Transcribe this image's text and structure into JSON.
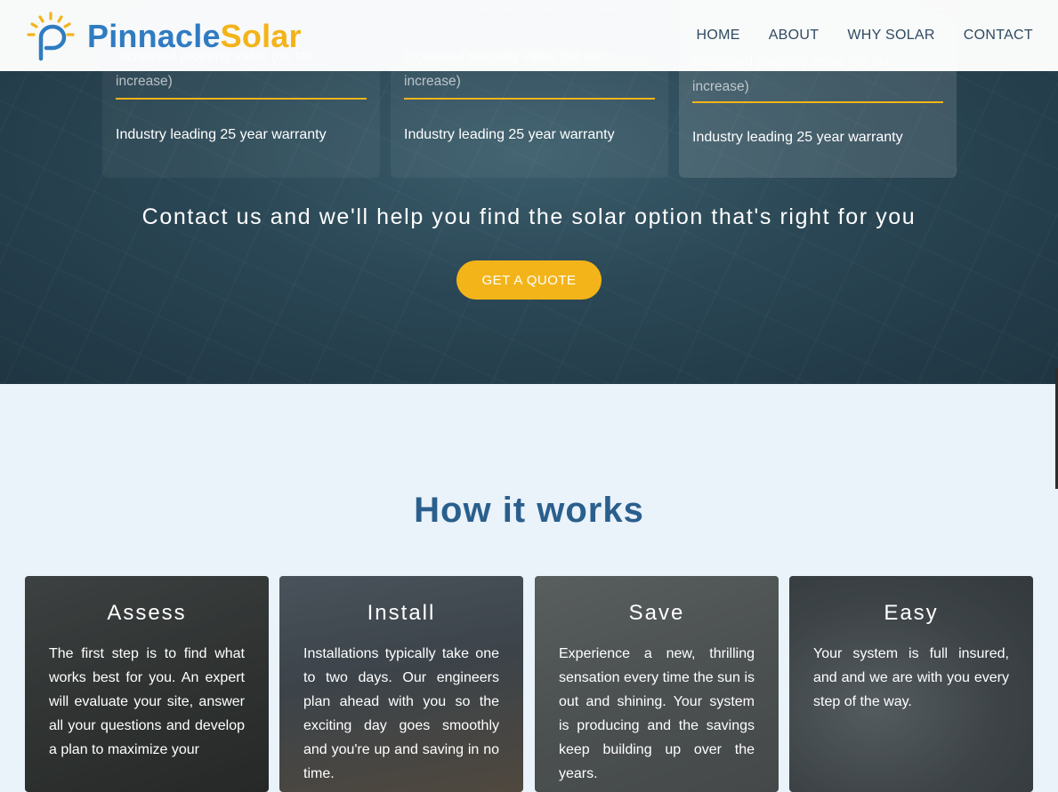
{
  "header": {
    "brand_part1": "Pinnacle",
    "brand_part2": "Solar",
    "logo_icon": "sun-p-logo-icon",
    "nav": [
      "HOME",
      "ABOUT",
      "WHY SOLAR",
      "CONTACT"
    ]
  },
  "plans": [
    {
      "feature": "Increased property value (no tax increase)",
      "warranty": "Industry leading 25 year warranty"
    },
    {
      "feature": "Increased property value (no tax increase)",
      "warranty": "Industry leading 25 year warranty"
    },
    {
      "feature": "Increased property value (no tax increase)",
      "warranty": "Industry leading 25 year warranty"
    }
  ],
  "cta": {
    "text": "Contact us and we'll help you find the solar option that's right for you",
    "button": "GET A QUOTE"
  },
  "how": {
    "title": "How it works",
    "steps": [
      {
        "title": "Assess",
        "text": "The first step is to find what works best for you. An expert will evaluate your site, answer all your questions and develop a plan to maximize your"
      },
      {
        "title": "Install",
        "text": "Installations typically take one to two days. Our engineers plan ahead with you so the exciting day goes smoothly and you're up and saving in no time."
      },
      {
        "title": "Save",
        "text": "Experience a new, thrilling sensation every time the sun is out and shining. Your system is producing and the savings keep building up over the years."
      },
      {
        "title": "Easy",
        "text": "Your system is full insured, and and we are with you every step of the way."
      }
    ]
  },
  "colors": {
    "accent": "#f3b41a",
    "brand_blue": "#2f7cc2",
    "heading_blue": "#2a5f8d",
    "hero_bg": "#2a4654"
  }
}
